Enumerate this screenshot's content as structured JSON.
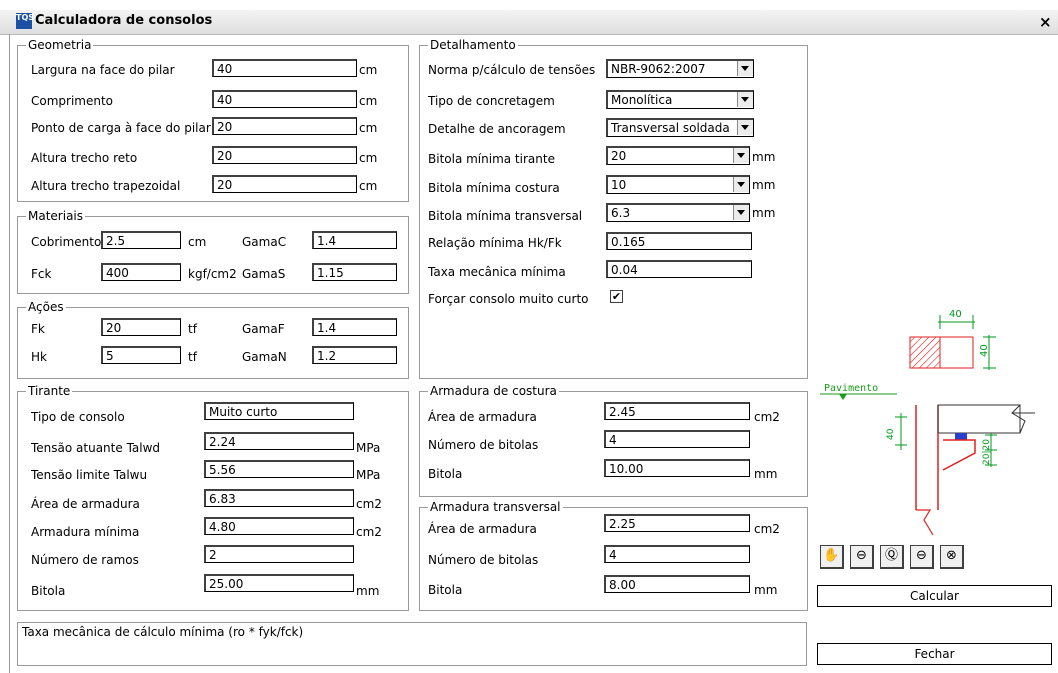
{
  "window": {
    "title": "Calculadora de consolos",
    "icon": "TQS",
    "close": "×"
  },
  "geometria": {
    "legend": "Geometria",
    "rows": [
      {
        "label": "Largura na face do pilar",
        "value": "40",
        "unit": "cm"
      },
      {
        "label": "Comprimento",
        "value": "40",
        "unit": "cm"
      },
      {
        "label": "Ponto de carga à face do pilar",
        "value": "20",
        "unit": "cm"
      },
      {
        "label": "Altura trecho reto",
        "value": "20",
        "unit": "cm"
      },
      {
        "label": "Altura trecho trapezoidal",
        "value": "20",
        "unit": "cm"
      }
    ]
  },
  "materiais": {
    "legend": "Materiais",
    "cobrimento": {
      "label": "Cobrimento",
      "value": "2.5",
      "unit": "cm"
    },
    "gamac": {
      "label": "GamaC",
      "value": "1.4"
    },
    "fck": {
      "label": "Fck",
      "value": "400",
      "unit": "kgf/cm2"
    },
    "gamas": {
      "label": "GamaS",
      "value": "1.15"
    }
  },
  "acoes": {
    "legend": "Ações",
    "fk": {
      "label": "Fk",
      "value": "20",
      "unit": "tf"
    },
    "gamaf": {
      "label": "GamaF",
      "value": "1.4"
    },
    "hk": {
      "label": "Hk",
      "value": "5",
      "unit": "tf"
    },
    "gaman": {
      "label": "GamaN",
      "value": "1.2"
    }
  },
  "tirante": {
    "legend": "Tirante",
    "rows": [
      {
        "label": "Tipo de consolo",
        "value": "Muito curto",
        "unit": ""
      },
      {
        "label": "Tensão atuante Talwd",
        "value": "2.24",
        "unit": "MPa"
      },
      {
        "label": "Tensão limite Talwu",
        "value": "5.56",
        "unit": "MPa"
      },
      {
        "label": "Área de armadura",
        "value": "6.83",
        "unit": "cm2"
      },
      {
        "label": "Armadura mínima",
        "value": "4.80",
        "unit": "cm2"
      },
      {
        "label": "Número de ramos",
        "value": "2",
        "unit": ""
      },
      {
        "label": "Bitola",
        "value": "25.00",
        "unit": "mm"
      }
    ]
  },
  "detalhamento": {
    "legend": "Detalhamento",
    "norma": {
      "label": "Norma p/cálculo de tensões",
      "value": "NBR-9062:2007"
    },
    "concretagem": {
      "label": "Tipo de concretagem",
      "value": "Monolítica"
    },
    "ancoragem": {
      "label": "Detalhe de ancoragem",
      "value": "Transversal soldada"
    },
    "bitola_tirante": {
      "label": "Bitola mínima tirante",
      "value": "20",
      "unit": "mm"
    },
    "bitola_costura": {
      "label": "Bitola mínima costura",
      "value": "10",
      "unit": "mm"
    },
    "bitola_transversal": {
      "label": "Bitola mínima transversal",
      "value": "6.3",
      "unit": "mm"
    },
    "relacao": {
      "label": "Relação mínima Hk/Fk",
      "value": "0.165"
    },
    "taxa": {
      "label": "Taxa mecânica mínima",
      "value": "0.04"
    },
    "forcar": {
      "label": "Forçar consolo muito curto",
      "checked": true,
      "mark": "✔"
    }
  },
  "costura": {
    "legend": "Armadura de costura",
    "rows": [
      {
        "label": "Área de armadura",
        "value": "2.45",
        "unit": "cm2"
      },
      {
        "label": "Número de bitolas",
        "value": "4",
        "unit": ""
      },
      {
        "label": "Bitola",
        "value": "10.00",
        "unit": "mm"
      }
    ]
  },
  "transversal": {
    "legend": "Armadura transversal",
    "rows": [
      {
        "label": "Área de armadura",
        "value": "2.25",
        "unit": "cm2"
      },
      {
        "label": "Número de bitolas",
        "value": "4",
        "unit": ""
      },
      {
        "label": "Bitola",
        "value": "8.00",
        "unit": "mm"
      }
    ]
  },
  "drawing": {
    "dim_width": "40",
    "dim_height": "40",
    "pavimento": "Pavimento",
    "dim_side": "40",
    "dim_right": "20|20"
  },
  "toolbar": [
    "pan-icon",
    "zoom-window-icon",
    "zoom-all-icon",
    "zoom-out-icon",
    "redraw-icon"
  ],
  "buttons": {
    "calcular": "Calcular",
    "fechar": "Fechar"
  },
  "hint": "Taxa mecânica de cálculo mínima (ro * fyk/fck)",
  "colors": {
    "drawing": "#e0201c",
    "dimension": "#009a1e",
    "pavimento": "#1a9a1a",
    "accent": "#2a3fd0"
  }
}
